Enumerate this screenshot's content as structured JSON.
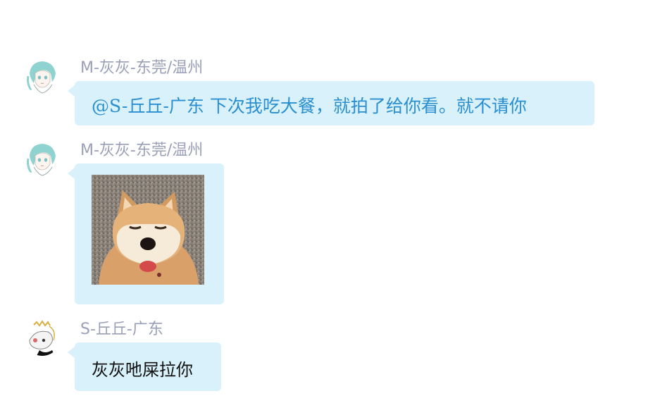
{
  "messages": [
    {
      "sender": "M-灰灰-东莞/温州",
      "text": "@S-丘丘-广东 下次我吃大餐，就拍了给你看。就不请你",
      "avatar_icon": "anime-girl-avatar-icon"
    },
    {
      "sender": "M-灰灰-东莞/温州",
      "image_icon": "shiba-inu-photo",
      "avatar_icon": "anime-girl-avatar-icon"
    },
    {
      "sender": "S-丘丘-广东",
      "text": "灰灰吔屎拉你",
      "avatar_icon": "cartoon-character-avatar-icon"
    }
  ],
  "colors": {
    "bubble": "#d9f1fb",
    "sender": "#9aa0b8",
    "mention": "#2a8fd1"
  }
}
